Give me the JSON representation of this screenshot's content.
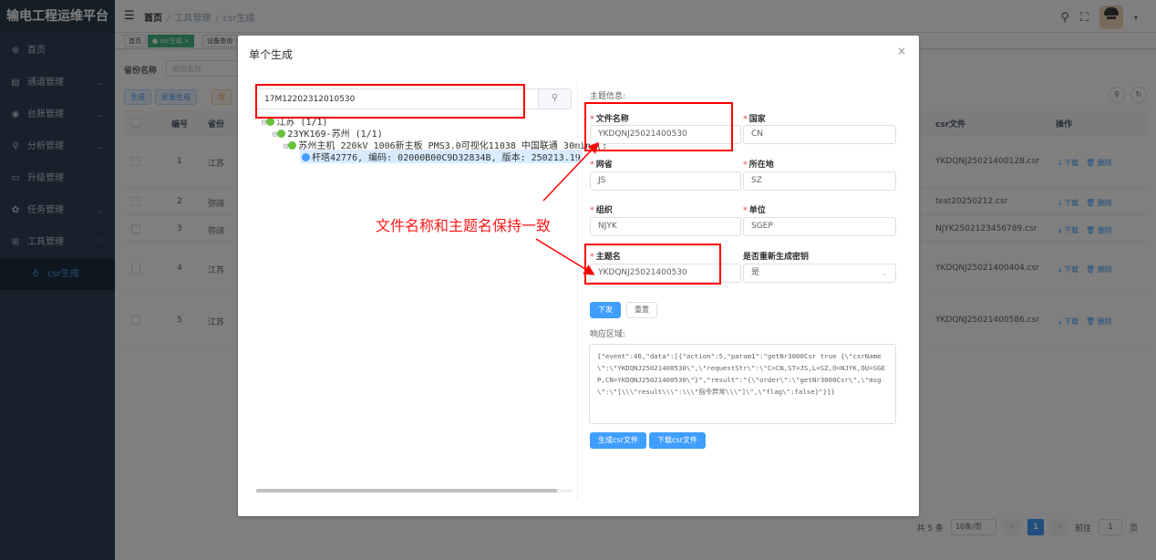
{
  "app": {
    "title": "输电工程运维平台"
  },
  "sidebar": {
    "items": [
      {
        "label": "首页",
        "icon": "dashboard-icon"
      },
      {
        "label": "通道管理",
        "icon": "document-icon"
      },
      {
        "label": "台账管理",
        "icon": "github-icon"
      },
      {
        "label": "分析管理",
        "icon": "chart-icon"
      },
      {
        "label": "升级管理",
        "icon": "monitor-icon"
      },
      {
        "label": "任务管理",
        "icon": "gear-icon"
      },
      {
        "label": "工具管理",
        "icon": "tool-icon"
      },
      {
        "label": "csr生成",
        "icon": "csr-icon"
      }
    ]
  },
  "header": {
    "breadcrumb": [
      "首页",
      "工具管理",
      "csr生成"
    ]
  },
  "tags": [
    "首页",
    "● csr生成 ×",
    "设备查询"
  ],
  "filter": {
    "label": "省份名称",
    "placeholder": "省份名称"
  },
  "toolbar": {
    "add": "生成",
    "batch": "批量生成",
    "export": "导"
  },
  "table": {
    "headers": [
      "编号",
      "省份",
      "csr文件",
      "操作"
    ],
    "rows": [
      {
        "no": "1",
        "province": "江苏",
        "csr": "YKDQNJ25021400128.csr"
      },
      {
        "no": "2",
        "province": "弥阔",
        "csr": "test20250212.csr"
      },
      {
        "no": "3",
        "province": "弥阔",
        "csr": "NJYK2502123456789.csr"
      },
      {
        "no": "4",
        "province": "江苏",
        "csr": "YKDQNJ25021400404.csr"
      },
      {
        "no": "5",
        "province": "江苏",
        "csr": "YKDQNJ25021400586.csr"
      }
    ],
    "download": "⤓ 下载",
    "delete": "🗑 删除"
  },
  "pager": {
    "total": "共 5 条",
    "size": "10条/页",
    "current": "1",
    "goto": "前往",
    "goto_value": "1",
    "page_unit": "页"
  },
  "dialog": {
    "title": "单个生成",
    "close": "×",
    "search_value": "17M12202312010530",
    "tree": [
      "江苏 (1/1)",
      "23YK169-苏州 (1/1)",
      "苏州主机_220kV_1006新主板_PMS3.0可视化11038_中国联通_30min (:",
      "杆塔42776, 编码: 02000B00C9D32834B, 版本: 250213.19"
    ],
    "section_title": "主题信息:",
    "fields": {
      "filename_label": "文件名称",
      "filename_value": "YKDQNJ25021400530",
      "country_label": "国家",
      "country_value": "CN",
      "province_label": "网省",
      "province_value": "JS",
      "location_label": "所在地",
      "location_value": "SZ",
      "org_label": "组织",
      "org_value": "NJYK",
      "unit_label": "单位",
      "unit_value": "SGEP",
      "subject_label": "主题名",
      "subject_value": "YKDQNJ25021400530",
      "regen_label": "是否重新生成密钥",
      "regen_value": "是"
    },
    "send": "下发",
    "reset": "重置",
    "response_label": "响应区域:",
    "response_text": "{\"event\":46,\"data\":[{\"action\":5,\"param1\":\"getNr3000Csr true {\\\"csrName\\\":\\\"YKDQNJ25021400530\\\",\\\"requestStr\\\":\\\"C=CN,ST=JS,L=SZ,O=NJYK,OU=SGEP,CN=YKDQNJ25021400530\\\"}\",\"result\":\"{\\\"order\\\":\\\"getNr3000Csr\\\",\\\"msg\\\":\\\"[\\\\\\\"result\\\\\\\":\\\\\\\"指令异常\\\\\\\"]\\\",\\\"flag\\\":false}\"}]}",
    "gen_csr": "生成csr文件",
    "download_csr": "下载csr文件"
  },
  "annotation": {
    "text": "文件名称和主题名保持一致",
    "color": "#ff0000"
  }
}
